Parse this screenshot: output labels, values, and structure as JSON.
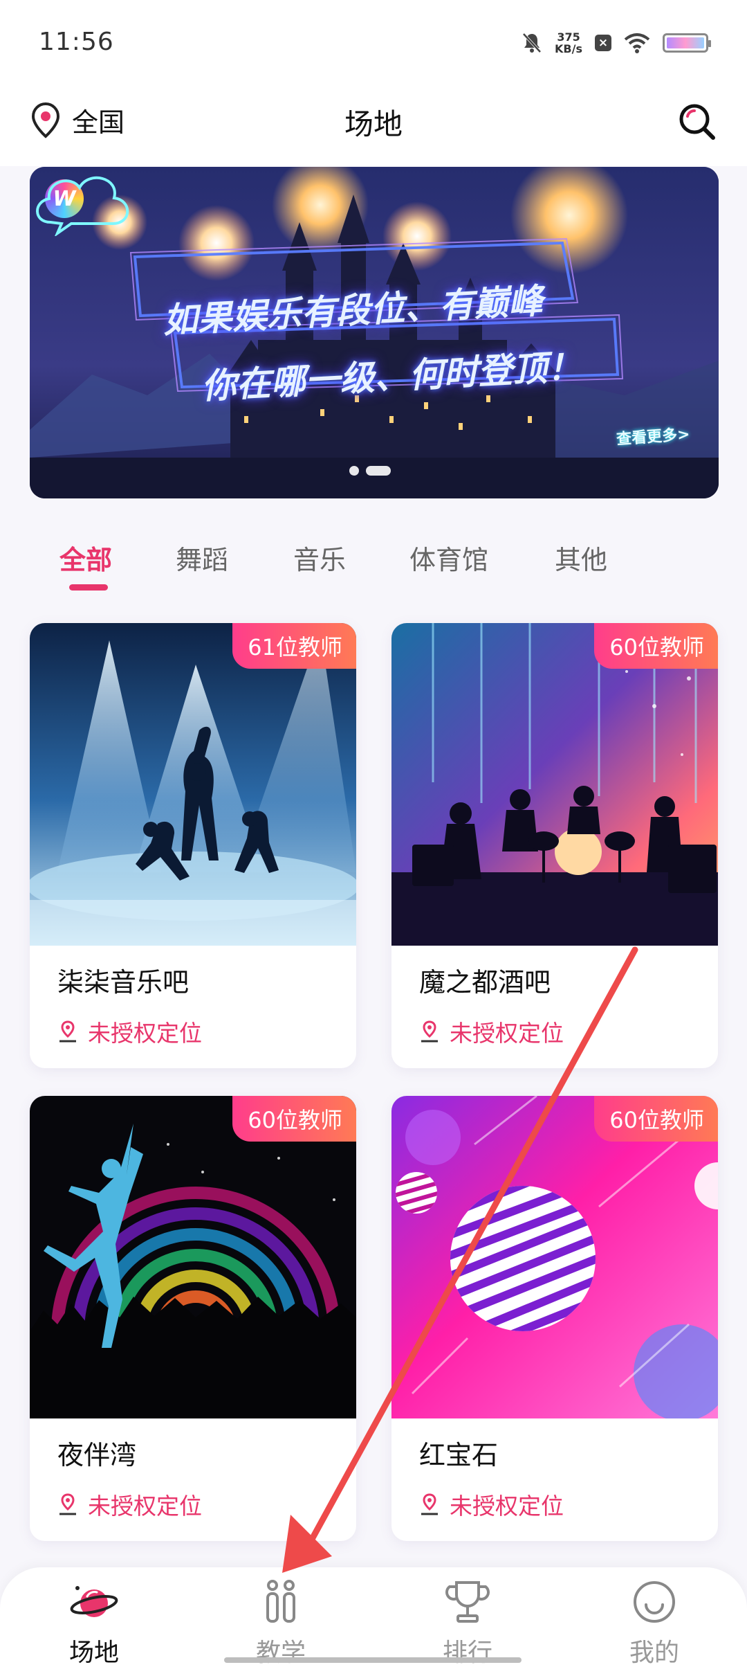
{
  "status_bar": {
    "time": "11:56",
    "net_speed_value": "375",
    "net_speed_unit": "KB/s",
    "icons": [
      "mute-icon",
      "close-box-icon",
      "wifi-icon",
      "battery-icon"
    ]
  },
  "header": {
    "location_label": "全国",
    "title": "场地",
    "icons": [
      "location-pin-icon",
      "search-icon"
    ]
  },
  "banner": {
    "line1": "如果娱乐有段位、有巅峰",
    "line2": "你在哪一级、何时登顶！",
    "more_label": "查看更多>",
    "logo_letter": "W",
    "pages": 2,
    "active_page": 2
  },
  "tabs": [
    {
      "label": "全部",
      "active": true
    },
    {
      "label": "舞蹈",
      "active": false
    },
    {
      "label": "音乐",
      "active": false
    },
    {
      "label": "体育馆",
      "active": false
    },
    {
      "label": "其他",
      "active": false
    }
  ],
  "venues": [
    {
      "name": "柒柒音乐吧",
      "badge": "61位教师",
      "location": "未授权定位",
      "image": "dancers-spotlight"
    },
    {
      "name": "魔之都酒吧",
      "badge": "60位教师",
      "location": "未授权定位",
      "image": "band-stage"
    },
    {
      "name": "夜伴湾",
      "badge": "60位教师",
      "location": "未授权定位",
      "image": "dancer-concert"
    },
    {
      "name": "红宝石",
      "badge": "60位教师",
      "location": "未授权定位",
      "image": "striped-sphere"
    }
  ],
  "bottom_nav": [
    {
      "label": "场地",
      "icon": "planet-icon",
      "active": true
    },
    {
      "label": "教学",
      "icon": "teaching-icon",
      "active": false
    },
    {
      "label": "排行",
      "icon": "trophy-icon",
      "active": false
    },
    {
      "label": "我的",
      "icon": "smile-icon",
      "active": false
    }
  ],
  "colors": {
    "accent": "#e8356b",
    "badge_start": "#ff3d8b",
    "badge_end": "#ff7a55",
    "background": "#f7f6fb",
    "annotation_arrow": "#ee4a4a"
  }
}
